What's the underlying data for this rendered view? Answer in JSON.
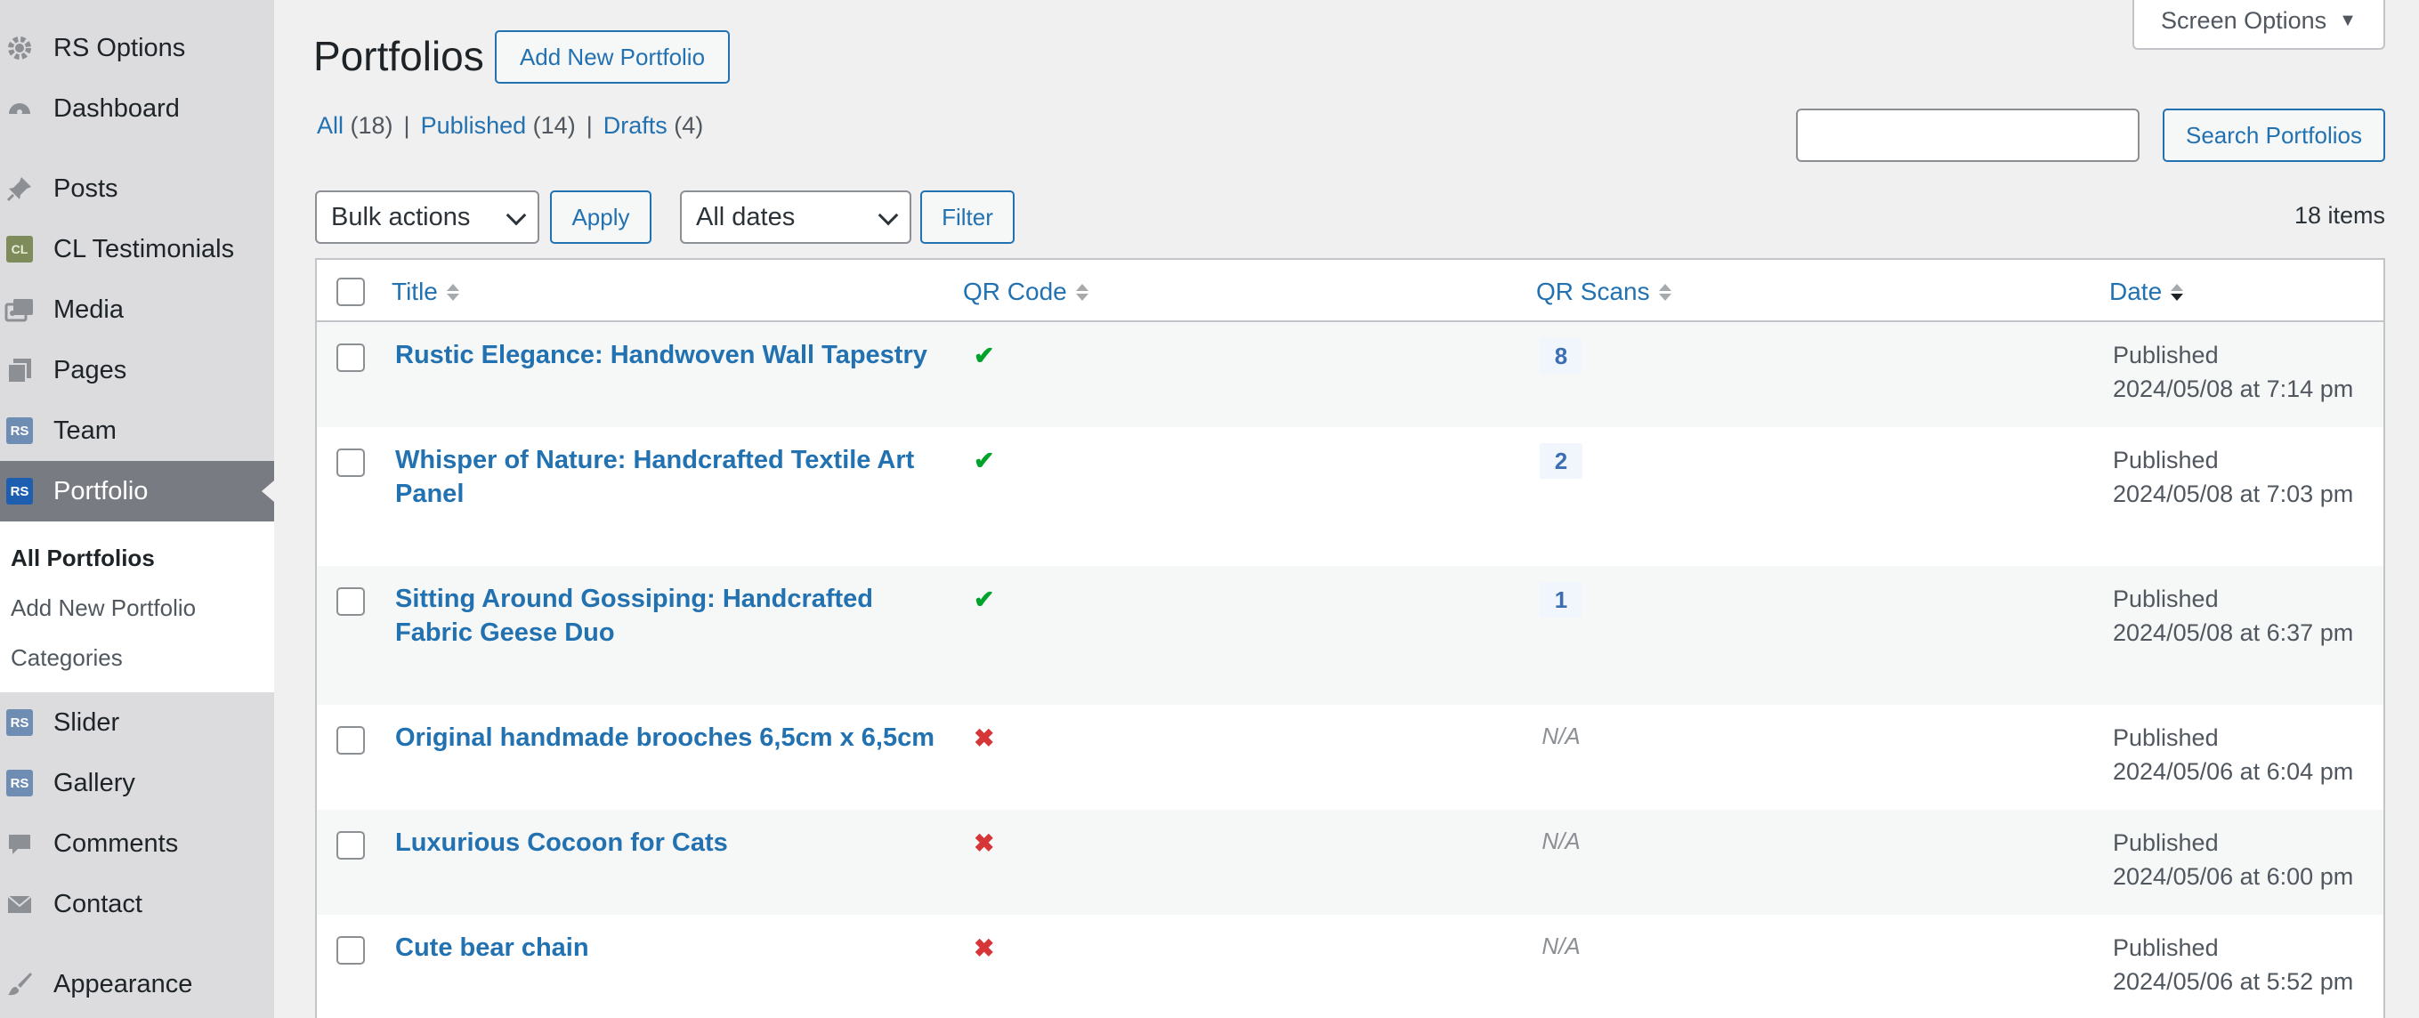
{
  "sidebar": {
    "items": [
      {
        "label": "RS Options",
        "icon": "gear-icon"
      },
      {
        "label": "Dashboard",
        "icon": "dashboard-icon"
      },
      {
        "label": "Posts",
        "icon": "pin-icon"
      },
      {
        "label": "CL Testimonials",
        "icon": "cl-icon",
        "badge": "CL"
      },
      {
        "label": "Media",
        "icon": "media-icon"
      },
      {
        "label": "Pages",
        "icon": "pages-icon"
      },
      {
        "label": "Team",
        "icon": "rs-icon",
        "badge": "RS"
      },
      {
        "label": "Portfolio",
        "icon": "rs-icon",
        "badge": "RS"
      },
      {
        "label": "Slider",
        "icon": "rs-icon",
        "badge": "RS"
      },
      {
        "label": "Gallery",
        "icon": "rs-icon",
        "badge": "RS"
      },
      {
        "label": "Comments",
        "icon": "comment-icon"
      },
      {
        "label": "Contact",
        "icon": "mail-icon"
      },
      {
        "label": "Appearance",
        "icon": "brush-icon"
      }
    ],
    "submenu": [
      "All Portfolios",
      "Add New Portfolio",
      "Categories"
    ],
    "active_color": "#787c82"
  },
  "header": {
    "title": "Portfolios",
    "add_new": "Add New Portfolio",
    "screen_options": "Screen Options"
  },
  "filters": {
    "all": "All",
    "all_count": "(18)",
    "published": "Published",
    "published_count": "(14)",
    "drafts": "Drafts",
    "drafts_count": "(4)",
    "sep": "|"
  },
  "search": {
    "button": "Search Portfolios",
    "value": ""
  },
  "toolbar": {
    "bulk": "Bulk actions",
    "apply": "Apply",
    "dates": "All dates",
    "filter": "Filter",
    "count": "18 items"
  },
  "table": {
    "columns": [
      "Title",
      "QR Code",
      "QR Scans",
      "Date"
    ],
    "rows": [
      {
        "title": "Rustic Elegance: Handwoven Wall Tapestry",
        "qr": "✔",
        "scans": "8",
        "status": "Published",
        "date": "2024/05/08 at 7:14 pm"
      },
      {
        "title": "Whisper of Nature: Handcrafted Textile Art Panel",
        "qr": "✔",
        "scans": "2",
        "status": "Published",
        "date": "2024/05/08 at 7:03 pm"
      },
      {
        "title": "Sitting Around Gossiping: Handcrafted Fabric Geese Duo",
        "qr": "✔",
        "scans": "1",
        "status": "Published",
        "date": "2024/05/08 at 6:37 pm"
      },
      {
        "title": "Original handmade brooches 6,5cm x 6,5cm",
        "qr": "✖",
        "scans": "N/A",
        "status": "Published",
        "date": "2024/05/06 at 6:04 pm"
      },
      {
        "title": "Luxurious Cocoon for Cats",
        "qr": "✖",
        "scans": "N/A",
        "status": "Published",
        "date": "2024/05/06 at 6:00 pm"
      },
      {
        "title": "Cute bear chain",
        "qr": "✖",
        "scans": "N/A",
        "status": "Published",
        "date": "2024/05/06 at 5:52 pm"
      }
    ]
  }
}
